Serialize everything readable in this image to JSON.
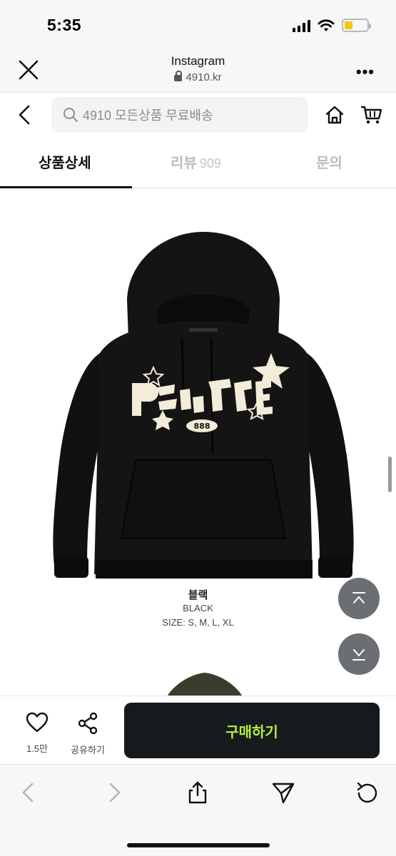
{
  "status_bar": {
    "time": "5:35",
    "battery_level": 0.35
  },
  "browser": {
    "title": "Instagram",
    "url": "4910.kr",
    "more_label": "•••"
  },
  "shop_header": {
    "search_placeholder": "4910 모든상품 무료배송"
  },
  "tabs": [
    {
      "label": "상품상세",
      "count": "",
      "active": true
    },
    {
      "label": "리뷰",
      "count": "909",
      "active": false
    },
    {
      "label": "문의",
      "count": "",
      "active": false
    }
  ],
  "product": {
    "color_name_kr": "블랙",
    "color_name_en": "BLACK",
    "sizes": "SIZE: S, M, L, XL",
    "graphic_text": "P",
    "badge_text": "888"
  },
  "purchase_bar": {
    "like_count": "1.5만",
    "share_label": "공유하기",
    "buy_label": "구매하기"
  },
  "colors": {
    "buy_button_bg": "#161a1d",
    "buy_button_text": "#b4f03c",
    "hoodie": "#141414",
    "print": "#f2ecd8"
  },
  "icons": [
    "close-icon",
    "lock-icon",
    "more-icon",
    "back-icon",
    "search-icon",
    "home-icon",
    "cart-icon",
    "scroll-top-icon",
    "scroll-bottom-icon",
    "heart-icon",
    "share-icon",
    "browser-back-icon",
    "browser-forward-icon",
    "share-sheet-icon",
    "send-icon",
    "reload-icon"
  ]
}
